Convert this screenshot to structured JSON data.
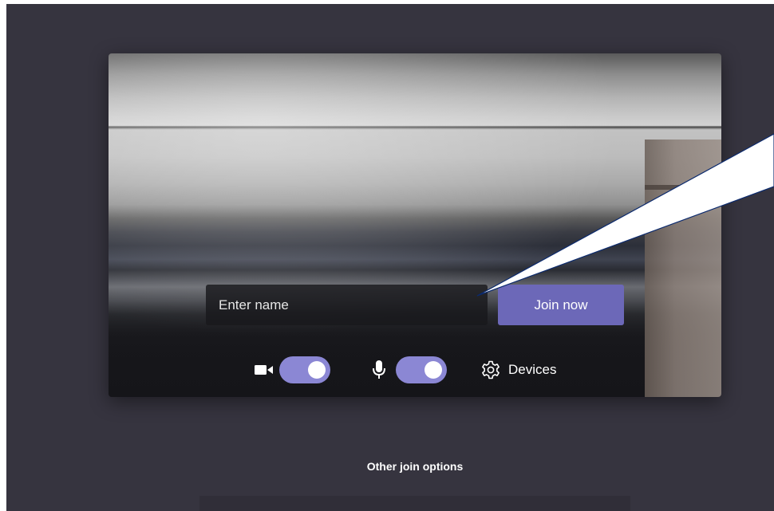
{
  "join_screen": {
    "name_placeholder": "Enter name",
    "join_label": "Join now",
    "devices_label": "Devices",
    "camera_icon": "camera-icon",
    "microphone_icon": "microphone-icon",
    "devices_icon": "gear-icon",
    "camera_toggle_on": true,
    "mic_toggle_on": true
  },
  "other_join_options": {
    "heading": "Other join options"
  },
  "colors": {
    "background": "#36343f",
    "accent": "#6c68b8",
    "toggle_on": "#8b87d4",
    "callout": "#ffffff"
  }
}
